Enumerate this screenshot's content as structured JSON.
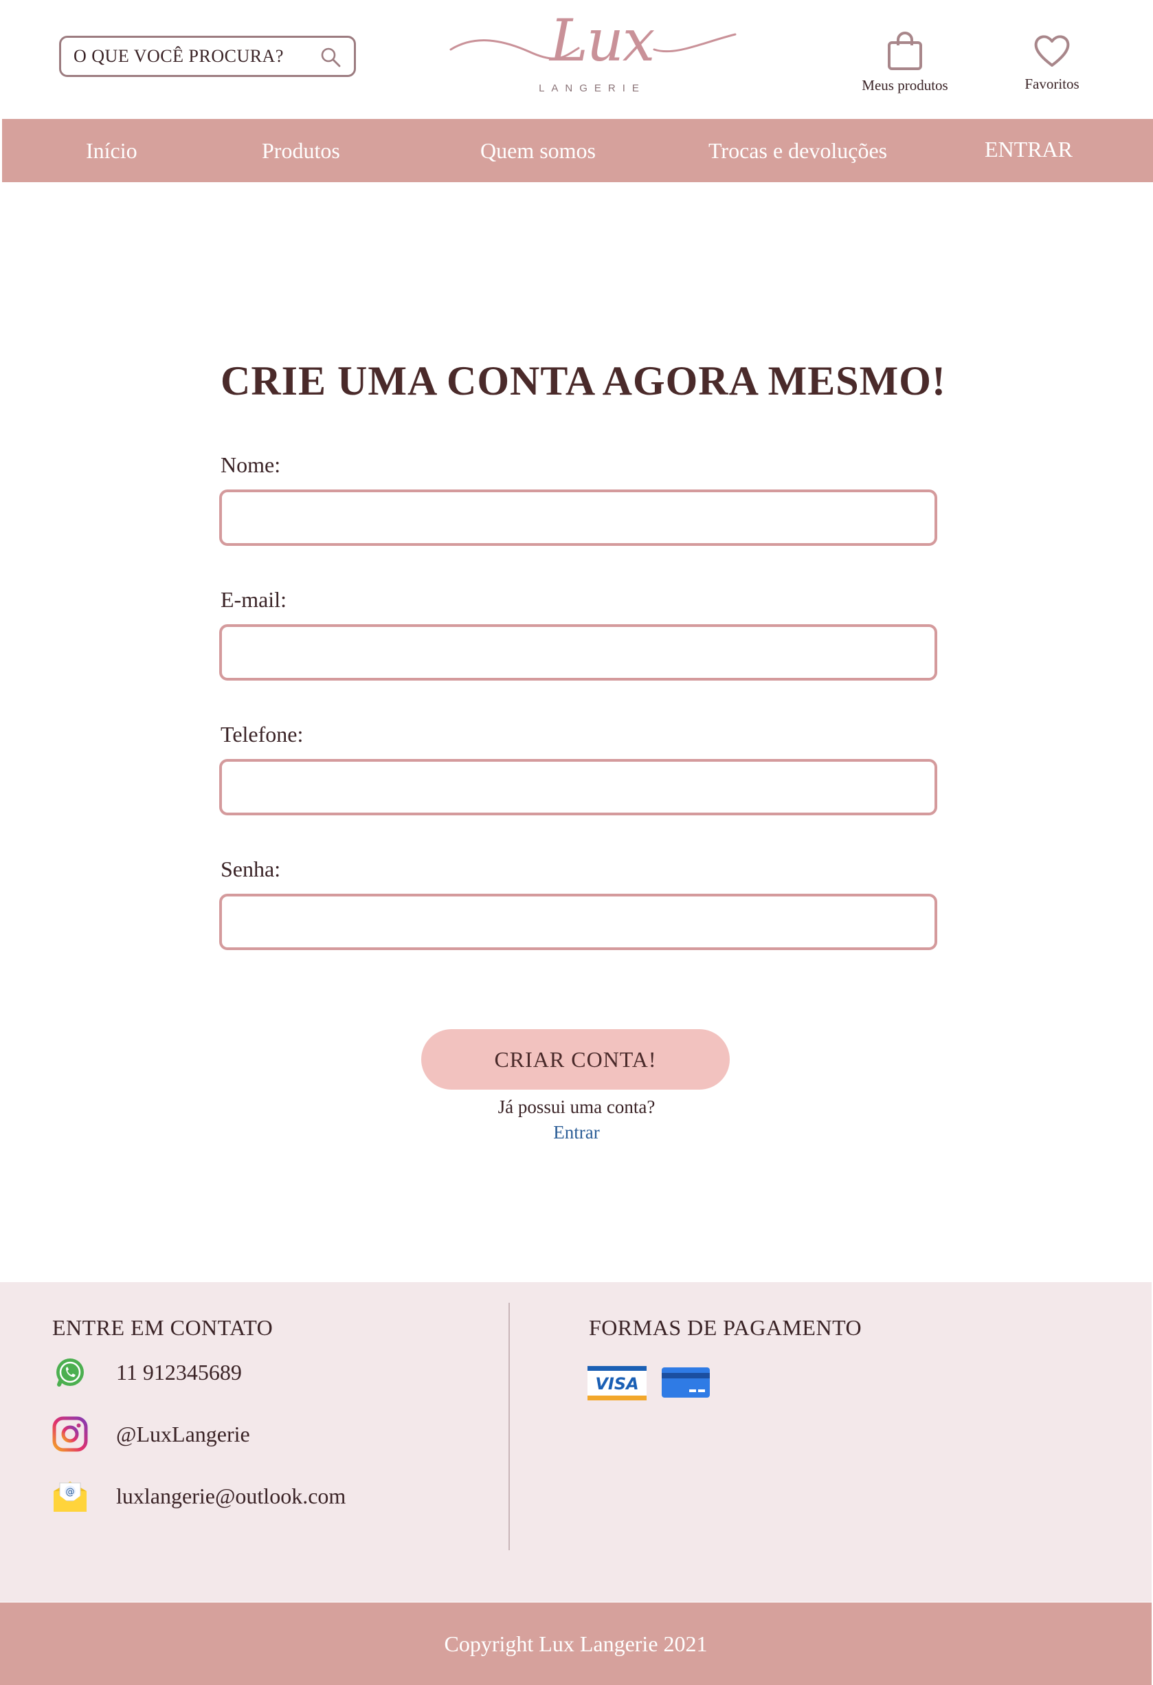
{
  "header": {
    "search_placeholder": "O QUE VOCÊ PROCURA?",
    "logo_text": "Lux",
    "logo_subtitle": "LANGERIE",
    "cart_label": "Meus produtos",
    "favorites_label": "Favoritos"
  },
  "nav": {
    "items": [
      "Início",
      "Produtos",
      "Quem somos",
      "Trocas e devoluções"
    ],
    "login": "ENTRAR"
  },
  "form": {
    "title": "CRIE UMA CONTA AGORA MESMO!",
    "fields": [
      {
        "label": "Nome:",
        "value": ""
      },
      {
        "label": "E-mail:",
        "value": ""
      },
      {
        "label": "Telefone:",
        "value": ""
      },
      {
        "label": "Senha:",
        "value": ""
      }
    ],
    "submit_label": "CRIAR CONTA!",
    "have_account": "Já possui uma conta?",
    "login_link": "Entrar"
  },
  "footer": {
    "contact_heading": "ENTRE EM CONTATO",
    "contacts": [
      {
        "icon": "whatsapp-icon",
        "text": "11 912345689"
      },
      {
        "icon": "instagram-icon",
        "text": "@LuxLangerie"
      },
      {
        "icon": "email-icon",
        "text": "luxlangerie@outlook.com"
      }
    ],
    "payment_heading": "FORMAS DE PAGAMENTO",
    "payment_methods": [
      "VISA",
      "credit-card"
    ],
    "copyright": "Copyright Lux Langerie 2021"
  },
  "colors": {
    "nav_bg": "#d6a19c",
    "input_border": "#d49a9c",
    "button_bg": "#f2c2bf",
    "footer_bg": "#f3e8ea",
    "link": "#2b5d96",
    "text": "#4a2a2a"
  }
}
